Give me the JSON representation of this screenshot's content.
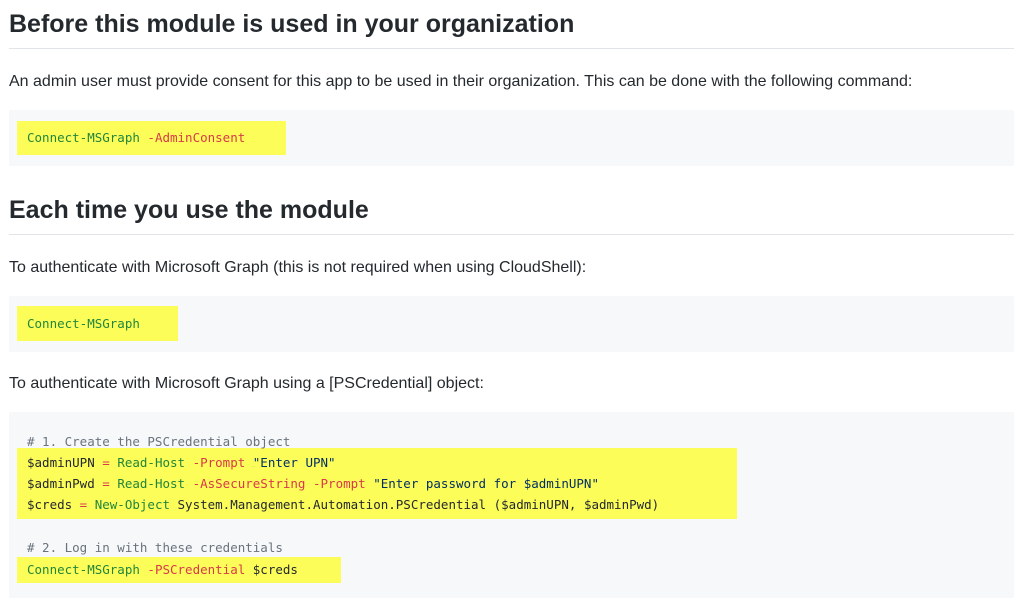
{
  "section1": {
    "heading": "Before this module is used in your organization",
    "text": "An admin user must provide consent for this app to be used in their organization. This can be done with the following command:",
    "code": {
      "cmd": "Connect-MSGraph",
      "arg": " -AdminConsent"
    }
  },
  "section2": {
    "heading": "Each time you use the module",
    "text1": "To authenticate with Microsoft Graph (this is not required when using CloudShell):",
    "code1": {
      "cmd": "Connect-MSGraph"
    },
    "text2": "To authenticate with Microsoft Graph using a [PSCredential] object:",
    "code2": {
      "comment1": "# 1. Create the PSCredential object",
      "l1_var": "$adminUPN",
      "l1_eq": " = ",
      "l1_cmd": "Read-Host",
      "l1_param": " -Prompt ",
      "l1_str": "\"Enter UPN\"",
      "l2_var": "$adminPwd",
      "l2_eq": " = ",
      "l2_cmd": "Read-Host",
      "l2_param1": " -AsSecureString",
      "l2_param2": " -Prompt ",
      "l2_str": "\"Enter password for $adminUPN\"",
      "l3_var": "$creds",
      "l3_eq": " = ",
      "l3_cmd": "New-Object",
      "l3_rest": " System.Management.Automation.PSCredential (",
      "l3_a1": "$adminUPN",
      "l3_comma": ", ",
      "l3_a2": "$adminPwd",
      "l3_close": ")",
      "comment2": "# 2. Log in with these credentials",
      "l4_cmd": "Connect-MSGraph",
      "l4_param": " -PSCredential ",
      "l4_var": "$creds"
    }
  },
  "colors": {
    "highlight": "#fdfd5a",
    "code_bg": "#f6f8fa"
  }
}
